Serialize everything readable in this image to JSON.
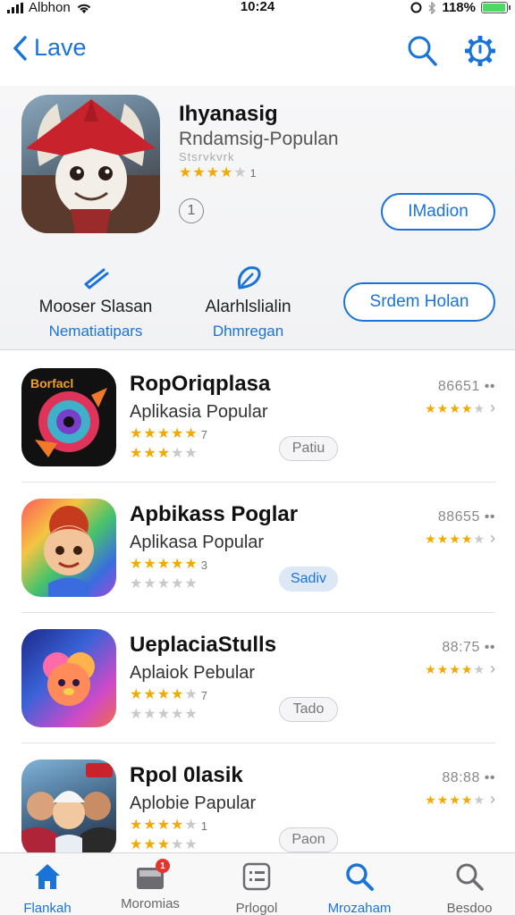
{
  "status_bar": {
    "carrier": "Albhon",
    "time": "10:24",
    "battery": "118%",
    "battery_level": 0.95
  },
  "nav": {
    "back_label": "Lave",
    "icons": [
      "search-icon",
      "gear-icon"
    ],
    "accent_color": "#1a73d9"
  },
  "hero": {
    "title": "Ihyanasig",
    "subtitle": "Rndamsig-Populan",
    "rating_text": "Stsrvkvrk",
    "rating": 3.5,
    "rating_count": "1",
    "info_symbol": "1",
    "action_label": "IMadion",
    "feature_a": {
      "label": "Mooser Slasan",
      "sub": "Nematiatipars",
      "icon": "feature-pen-icon"
    },
    "feature_b": {
      "label": "Alarhlslialin",
      "sub": "Dhmregan",
      "icon": "feature-leaf-icon"
    },
    "secondary_label": "Srdem Holan"
  },
  "apps": [
    {
      "title": "RopOriqplasa",
      "subtitle": "Aplikasia Popular",
      "rating": 5,
      "rating_count": "7",
      "rating2": 3,
      "pill": "Patiu",
      "pill_active": false,
      "size": "86651 ••",
      "side_rating": 4
    },
    {
      "title": "Apbikass Poglar",
      "subtitle": "Aplikasa Popular",
      "rating": 5,
      "rating_count": "3",
      "rating2": 0,
      "pill": "Sadiv",
      "pill_active": true,
      "size": "88655 ••",
      "side_rating": 4
    },
    {
      "title": "UeplaciaStulls",
      "subtitle": "Aplaiok Pebular",
      "rating": 4,
      "rating_count": "7",
      "rating2": 0,
      "pill": "Tado",
      "pill_active": false,
      "size": "88:75 ••",
      "side_rating": 4
    },
    {
      "title": "Rpol 0lasik",
      "subtitle": "Aplobie Papular",
      "rating": 4,
      "rating_count": "1",
      "rating2": 3,
      "pill": "Paon",
      "pill_active": false,
      "size": "88:88 ••",
      "side_rating": 4
    }
  ],
  "tabs": [
    {
      "label": "Flankah",
      "icon": "home-icon",
      "active": true
    },
    {
      "label": "Moromias",
      "icon": "inbox-icon",
      "badge": "1"
    },
    {
      "label": "Prlogol",
      "icon": "list-icon"
    },
    {
      "label": "Mrozaham",
      "icon": "search-icon",
      "active": true
    },
    {
      "label": "Besdoo",
      "icon": "search-icon"
    }
  ]
}
